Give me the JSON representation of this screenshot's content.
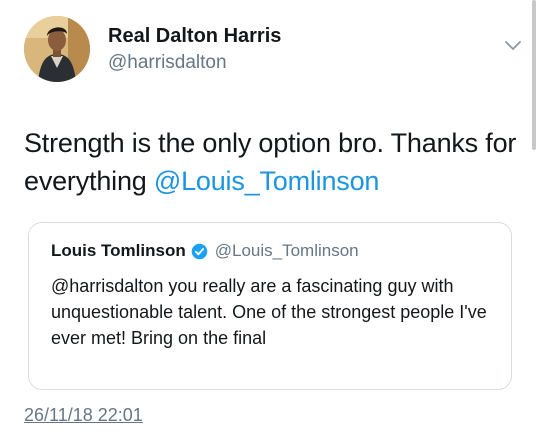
{
  "tweet": {
    "author": {
      "display_name": "Real Dalton Harris",
      "handle": "@harrisdalton",
      "avatar_icon": "profile-photo"
    },
    "menu_icon": "chevron-down-icon",
    "text_prefix": "Strength is the only option bro.  Thanks for everything ",
    "mention": "@Louis_Tomlinson",
    "timestamp": "26/11/18 22:01"
  },
  "quoted_tweet": {
    "display_name": "Louis Tomlinson",
    "verified": true,
    "handle": "@Louis_Tomlinson",
    "text": "@harrisdalton you really are a fascinating guy with unquestionable talent. One of the strongest people I've ever met! Bring on the final"
  },
  "colors": {
    "link": "#1b95e0",
    "secondary_text": "#657786",
    "primary_text": "#14171a",
    "verified_badge": "#1da1f2",
    "border": "#d7dde2"
  }
}
